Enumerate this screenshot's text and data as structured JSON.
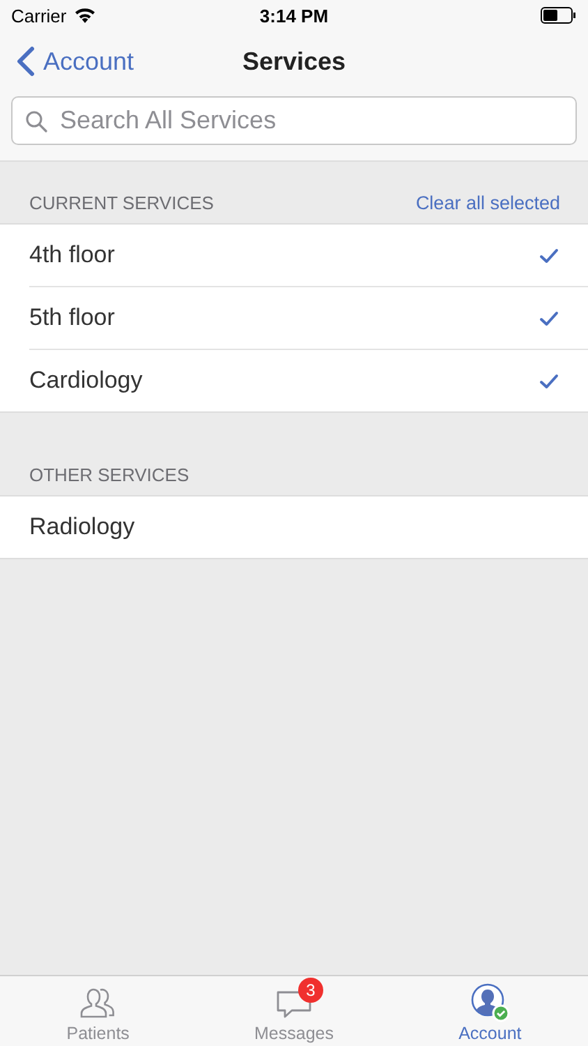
{
  "status_bar": {
    "carrier": "Carrier",
    "time": "3:14 PM"
  },
  "nav": {
    "back": "Account",
    "title": "Services"
  },
  "search": {
    "placeholder": "Search All Services"
  },
  "sections": [
    {
      "title": "CURRENT SERVICES",
      "action": "Clear all selected",
      "items": [
        {
          "label": "4th floor",
          "checked": true
        },
        {
          "label": "5th floor",
          "checked": true
        },
        {
          "label": "Cardiology",
          "checked": true
        }
      ]
    },
    {
      "title": "OTHER SERVICES",
      "items": [
        {
          "label": "Radiology",
          "checked": false
        }
      ]
    }
  ],
  "tabs": [
    {
      "label": "Patients",
      "kind": "people",
      "selected": false
    },
    {
      "label": "Messages",
      "kind": "chat",
      "selected": false,
      "badge": "3"
    },
    {
      "label": "Account",
      "kind": "account",
      "selected": true
    }
  ]
}
